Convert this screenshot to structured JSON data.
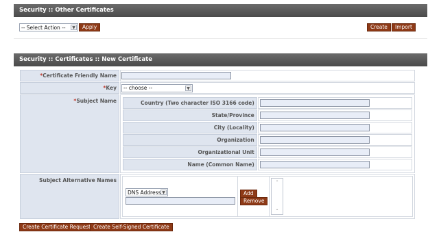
{
  "other_certs": {
    "title": "Security :: Other Certificates",
    "select_action": "-- Select Action --",
    "apply_label": "Apply",
    "create_label": "Create",
    "import_label": "Import"
  },
  "new_cert": {
    "title": "Security :: Certificates :: New Certificate",
    "required_mark": "*",
    "friendly_name_label": "Certificate Friendly Name",
    "key_label": "Key",
    "key_selected": "-- choose --",
    "subject_name_label": "Subject Name",
    "subject_fields": [
      {
        "label": "Country (Two character ISO 3166 code)"
      },
      {
        "label": "State/Province"
      },
      {
        "label": "City (Locality)"
      },
      {
        "label": "Organization"
      },
      {
        "label": "Organizational Unit"
      },
      {
        "label": "Name (Common Name)"
      }
    ],
    "san_label": "Subject Alternative Names",
    "san_type_selected": "DNS Address",
    "add_label": "Add",
    "remove_label": "Remove",
    "create_request_label": "Create Certificate Request",
    "create_selfsigned_label": "Create Self-Signed Certificate"
  },
  "icons": {
    "dropdown": "chevron-down-icon",
    "scroll_up": "scroll-up-icon",
    "scroll_down": "scroll-down-icon"
  }
}
